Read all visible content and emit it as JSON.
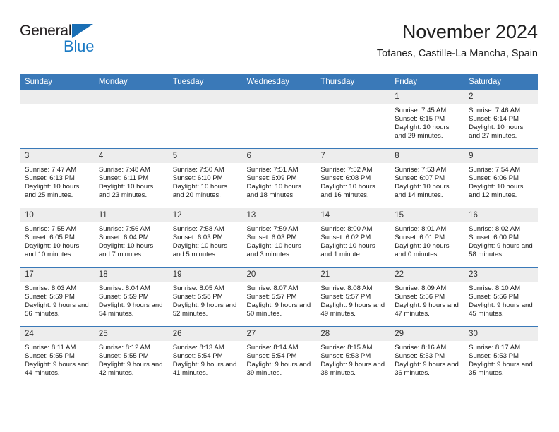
{
  "brand": {
    "name_top": "General",
    "name_bottom": "Blue",
    "accent_color": "#1a7ac4"
  },
  "header": {
    "title": "November 2024",
    "subtitle": "Totanes, Castille-La Mancha, Spain"
  },
  "calendar": {
    "header_color": "#3a79b8",
    "daynum_band_color": "#ededed",
    "weekday_headers": [
      "Sunday",
      "Monday",
      "Tuesday",
      "Wednesday",
      "Thursday",
      "Friday",
      "Saturday"
    ],
    "weeks": [
      [
        {
          "day": "",
          "lines": []
        },
        {
          "day": "",
          "lines": []
        },
        {
          "day": "",
          "lines": []
        },
        {
          "day": "",
          "lines": []
        },
        {
          "day": "",
          "lines": []
        },
        {
          "day": "1",
          "lines": [
            "Sunrise: 7:45 AM",
            "Sunset: 6:15 PM",
            "Daylight: 10 hours and 29 minutes."
          ]
        },
        {
          "day": "2",
          "lines": [
            "Sunrise: 7:46 AM",
            "Sunset: 6:14 PM",
            "Daylight: 10 hours and 27 minutes."
          ]
        }
      ],
      [
        {
          "day": "3",
          "lines": [
            "Sunrise: 7:47 AM",
            "Sunset: 6:13 PM",
            "Daylight: 10 hours and 25 minutes."
          ]
        },
        {
          "day": "4",
          "lines": [
            "Sunrise: 7:48 AM",
            "Sunset: 6:11 PM",
            "Daylight: 10 hours and 23 minutes."
          ]
        },
        {
          "day": "5",
          "lines": [
            "Sunrise: 7:50 AM",
            "Sunset: 6:10 PM",
            "Daylight: 10 hours and 20 minutes."
          ]
        },
        {
          "day": "6",
          "lines": [
            "Sunrise: 7:51 AM",
            "Sunset: 6:09 PM",
            "Daylight: 10 hours and 18 minutes."
          ]
        },
        {
          "day": "7",
          "lines": [
            "Sunrise: 7:52 AM",
            "Sunset: 6:08 PM",
            "Daylight: 10 hours and 16 minutes."
          ]
        },
        {
          "day": "8",
          "lines": [
            "Sunrise: 7:53 AM",
            "Sunset: 6:07 PM",
            "Daylight: 10 hours and 14 minutes."
          ]
        },
        {
          "day": "9",
          "lines": [
            "Sunrise: 7:54 AM",
            "Sunset: 6:06 PM",
            "Daylight: 10 hours and 12 minutes."
          ]
        }
      ],
      [
        {
          "day": "10",
          "lines": [
            "Sunrise: 7:55 AM",
            "Sunset: 6:05 PM",
            "Daylight: 10 hours and 10 minutes."
          ]
        },
        {
          "day": "11",
          "lines": [
            "Sunrise: 7:56 AM",
            "Sunset: 6:04 PM",
            "Daylight: 10 hours and 7 minutes."
          ]
        },
        {
          "day": "12",
          "lines": [
            "Sunrise: 7:58 AM",
            "Sunset: 6:03 PM",
            "Daylight: 10 hours and 5 minutes."
          ]
        },
        {
          "day": "13",
          "lines": [
            "Sunrise: 7:59 AM",
            "Sunset: 6:03 PM",
            "Daylight: 10 hours and 3 minutes."
          ]
        },
        {
          "day": "14",
          "lines": [
            "Sunrise: 8:00 AM",
            "Sunset: 6:02 PM",
            "Daylight: 10 hours and 1 minute."
          ]
        },
        {
          "day": "15",
          "lines": [
            "Sunrise: 8:01 AM",
            "Sunset: 6:01 PM",
            "Daylight: 10 hours and 0 minutes."
          ]
        },
        {
          "day": "16",
          "lines": [
            "Sunrise: 8:02 AM",
            "Sunset: 6:00 PM",
            "Daylight: 9 hours and 58 minutes."
          ]
        }
      ],
      [
        {
          "day": "17",
          "lines": [
            "Sunrise: 8:03 AM",
            "Sunset: 5:59 PM",
            "Daylight: 9 hours and 56 minutes."
          ]
        },
        {
          "day": "18",
          "lines": [
            "Sunrise: 8:04 AM",
            "Sunset: 5:59 PM",
            "Daylight: 9 hours and 54 minutes."
          ]
        },
        {
          "day": "19",
          "lines": [
            "Sunrise: 8:05 AM",
            "Sunset: 5:58 PM",
            "Daylight: 9 hours and 52 minutes."
          ]
        },
        {
          "day": "20",
          "lines": [
            "Sunrise: 8:07 AM",
            "Sunset: 5:57 PM",
            "Daylight: 9 hours and 50 minutes."
          ]
        },
        {
          "day": "21",
          "lines": [
            "Sunrise: 8:08 AM",
            "Sunset: 5:57 PM",
            "Daylight: 9 hours and 49 minutes."
          ]
        },
        {
          "day": "22",
          "lines": [
            "Sunrise: 8:09 AM",
            "Sunset: 5:56 PM",
            "Daylight: 9 hours and 47 minutes."
          ]
        },
        {
          "day": "23",
          "lines": [
            "Sunrise: 8:10 AM",
            "Sunset: 5:56 PM",
            "Daylight: 9 hours and 45 minutes."
          ]
        }
      ],
      [
        {
          "day": "24",
          "lines": [
            "Sunrise: 8:11 AM",
            "Sunset: 5:55 PM",
            "Daylight: 9 hours and 44 minutes."
          ]
        },
        {
          "day": "25",
          "lines": [
            "Sunrise: 8:12 AM",
            "Sunset: 5:55 PM",
            "Daylight: 9 hours and 42 minutes."
          ]
        },
        {
          "day": "26",
          "lines": [
            "Sunrise: 8:13 AM",
            "Sunset: 5:54 PM",
            "Daylight: 9 hours and 41 minutes."
          ]
        },
        {
          "day": "27",
          "lines": [
            "Sunrise: 8:14 AM",
            "Sunset: 5:54 PM",
            "Daylight: 9 hours and 39 minutes."
          ]
        },
        {
          "day": "28",
          "lines": [
            "Sunrise: 8:15 AM",
            "Sunset: 5:53 PM",
            "Daylight: 9 hours and 38 minutes."
          ]
        },
        {
          "day": "29",
          "lines": [
            "Sunrise: 8:16 AM",
            "Sunset: 5:53 PM",
            "Daylight: 9 hours and 36 minutes."
          ]
        },
        {
          "day": "30",
          "lines": [
            "Sunrise: 8:17 AM",
            "Sunset: 5:53 PM",
            "Daylight: 9 hours and 35 minutes."
          ]
        }
      ]
    ]
  }
}
